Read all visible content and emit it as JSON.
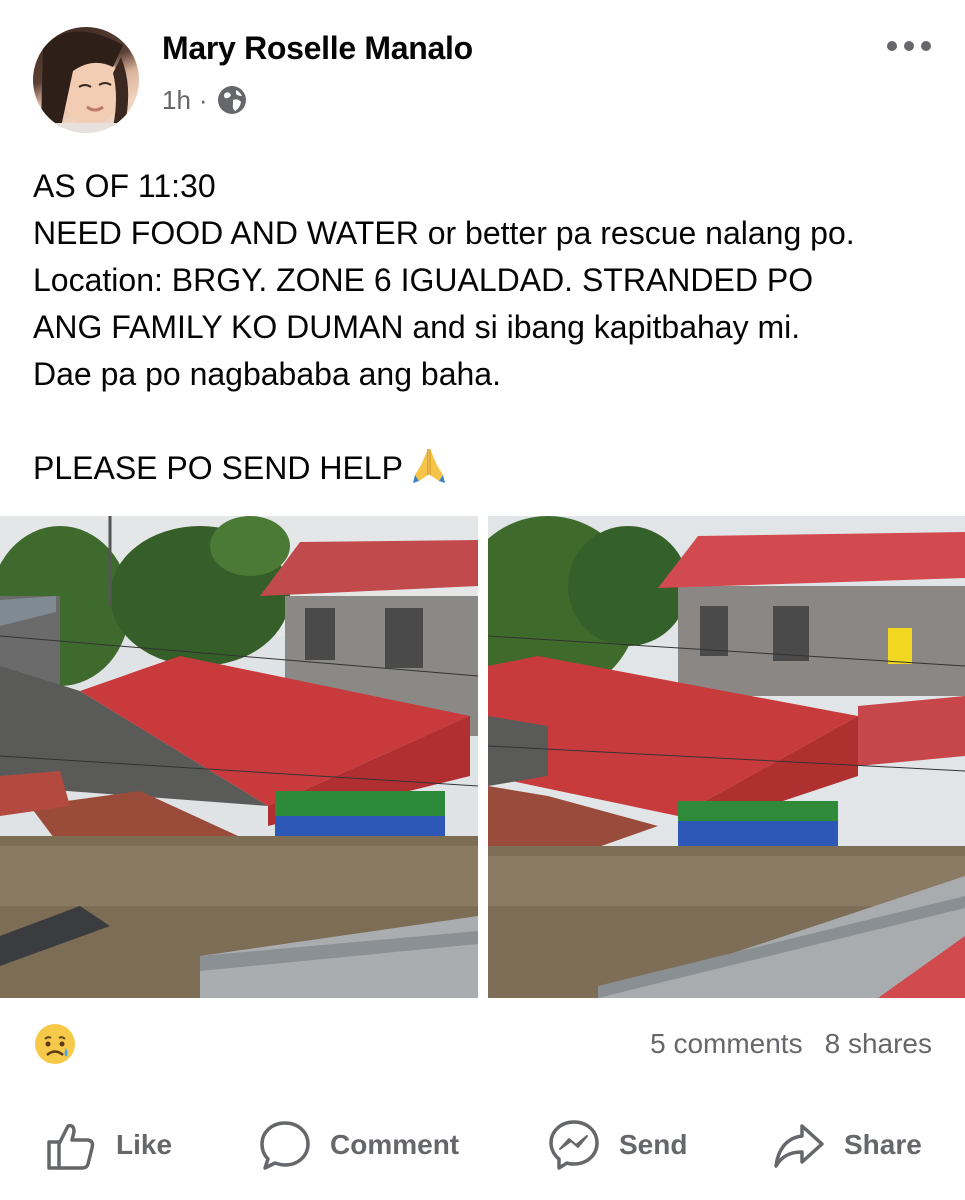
{
  "post": {
    "author": "Mary Roselle Manalo",
    "time": "1h",
    "separator": "·",
    "privacy_icon": "globe-icon",
    "text_lines": [
      "AS OF 11:30",
      "NEED FOOD AND WATER or better pa rescue nalang po.",
      "Location: BRGY. ZONE 6 IGUALDAD. STRANDED PO",
      "ANG FAMILY KO DUMAN and si ibang kapitbahay mi.",
      "Dae pa po nagbababa ang baha.",
      "",
      "PLEASE PO SEND HELP"
    ],
    "text_emoji_icon": "folded-hands-icon"
  },
  "photos": [
    {
      "icon": "flooded-houses-photo-1"
    },
    {
      "icon": "flooded-houses-photo-2"
    }
  ],
  "engagement": {
    "reaction_icon": "sad-reaction-icon",
    "comments": "5 comments",
    "shares": "8 shares"
  },
  "actions": {
    "like": "Like",
    "comment": "Comment",
    "send": "Send",
    "share": "Share"
  },
  "colors": {
    "secondary_text": "#65676b",
    "roof_red": "#c9383c",
    "flood_water": "#8a7a64"
  }
}
